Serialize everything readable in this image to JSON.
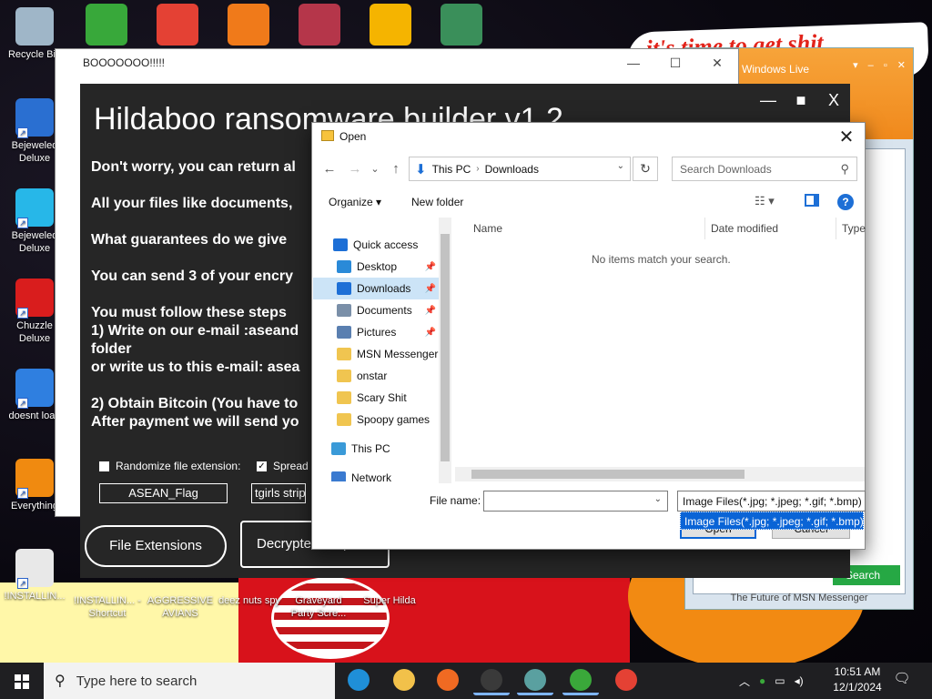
{
  "wallpaper": {
    "banner_text": "it's time to get shit"
  },
  "desktop_icons_left": [
    {
      "label": "Recycle Bin",
      "icon": "recycle-bin-icon",
      "color": "#9fb6c8"
    },
    {
      "label": "Bejeweled Deluxe",
      "icon": "bejeweled-red-gem-icon",
      "color": "#2a6fd1"
    },
    {
      "label": "Bejeweled Deluxe",
      "icon": "bejeweled-blue-gem-icon",
      "color": "#27b7e8"
    },
    {
      "label": "Chuzzle Deluxe",
      "icon": "chuzzle-icon",
      "color": "#d91d1d"
    },
    {
      "label": "doesnt load",
      "icon": "thunderbird-icon",
      "color": "#2f7fe0"
    },
    {
      "label": "Everything",
      "icon": "everything-search-icon",
      "color": "#f08a10"
    },
    {
      "label": "!INSTALLIN...",
      "icon": "document-icon",
      "color": "#e8e8e8"
    }
  ],
  "desktop_icons_top": [
    {
      "icon": "msn-messenger-icon",
      "color": "#38a83a"
    },
    {
      "icon": "chrome-icon",
      "color": "#e44134"
    },
    {
      "icon": "paint-p-icon",
      "color": "#f07a1a"
    },
    {
      "icon": "winrar-icon",
      "color": "#b5364a"
    },
    {
      "icon": "windows-shield-icon",
      "color": "#f5b400"
    },
    {
      "icon": "game-character-icon",
      "color": "#3a8f5a"
    }
  ],
  "desktop_icons_bottom": [
    {
      "label": "!INSTALLIN... - Shortcut"
    },
    {
      "label": "AGGRESSIVE AVIANS"
    },
    {
      "label": "deez nuts spy"
    },
    {
      "label": "Graveyard Party Scre..."
    },
    {
      "label": "Super Hilda"
    }
  ],
  "ransom_frame": {
    "title": "BOOOOOOO!!!!!",
    "min": "—",
    "max": "☐",
    "close": "✕"
  },
  "ransom": {
    "title": "Hildaboo ransomware builder v1.2",
    "lines": [
      "Don't worry, you can return al",
      "All your files like documents, ",
      "What guarantees do we give ",
      "You can send 3 of your encry",
      "You must follow these steps ",
      "1) Write on our e-mail :aseand",
      "folder",
      "or write us to this e-mail: asea",
      "2) Obtain Bitcoin (You have to",
      "After payment we will send yo"
    ],
    "check_randomize": "Randomize file extension:",
    "check_spread": "Spread",
    "ext_input": "ASEAN_Flag",
    "second_input": "tgirls strip",
    "btn_file_ext": "File Extensions",
    "btn_decrypter": "Decrypter & Options",
    "ctrl_min": "—",
    "ctrl_max": "■",
    "ctrl_close": "X"
  },
  "msn": {
    "title": "Windows Live",
    "controls": "▾ – ▫ ✕",
    "search_btn": "Search",
    "footer": "The Future of MSN Messenger"
  },
  "dialog": {
    "title": "Open",
    "close": "✕",
    "nav_back": "←",
    "nav_forward": "→",
    "nav_recent": "⌄",
    "nav_up": "↑",
    "breadcrumb": [
      "This PC",
      "Downloads"
    ],
    "search_placeholder": "Search Downloads",
    "organize": "Organize ▾",
    "new_folder": "New folder",
    "nav_items": [
      {
        "label": "Quick access",
        "icon": "star-icon",
        "color": "#1d6fd6",
        "pinned": false
      },
      {
        "label": "Desktop",
        "icon": "desktop-icon",
        "color": "#2a8ad8",
        "pinned": true
      },
      {
        "label": "Downloads",
        "icon": "downloads-icon",
        "color": "#1d6fd6",
        "pinned": true
      },
      {
        "label": "Documents",
        "icon": "documents-icon",
        "color": "#7a8fa8",
        "pinned": true
      },
      {
        "label": "Pictures",
        "icon": "pictures-icon",
        "color": "#5a7fb0",
        "pinned": true
      },
      {
        "label": "MSN Messenger",
        "icon": "folder-icon",
        "color": "#f0c550",
        "pinned": false
      },
      {
        "label": "onstar",
        "icon": "folder-icon",
        "color": "#f0c550",
        "pinned": false
      },
      {
        "label": "Scary Shit",
        "icon": "folder-icon",
        "color": "#f0c550",
        "pinned": false
      },
      {
        "label": "Spoopy games",
        "icon": "folder-icon",
        "color": "#f0c550",
        "pinned": false
      },
      {
        "label": "This PC",
        "icon": "this-pc-icon",
        "color": "#3a9ad8",
        "pinned": false
      },
      {
        "label": "Network",
        "icon": "network-icon",
        "color": "#3a7ad0",
        "pinned": false
      }
    ],
    "columns": [
      "Name",
      "Date modified",
      "Type"
    ],
    "empty_message": "No items match your search.",
    "filename_label": "File name:",
    "filename_value": "",
    "filter_value": "Image Files(*.jpg; *.jpeg; *.gif; *.bmp)",
    "filter_option": "Image Files(*.jpg; *.jpeg; *.gif; *.bmp)",
    "open_btn": "Open",
    "cancel_btn": "Cancel"
  },
  "taskbar": {
    "search_placeholder": "Type here to search",
    "apps": [
      {
        "icon": "edge-icon",
        "color": "#1f8fd8",
        "active": false
      },
      {
        "icon": "file-explorer-icon",
        "color": "#f2c14a",
        "active": false
      },
      {
        "icon": "firefox-icon",
        "color": "#f06a22",
        "active": false
      },
      {
        "icon": "chaos-app-icon",
        "color": "#3a3a3a",
        "active": true
      },
      {
        "icon": "app-window-icon",
        "color": "#5aa0a0",
        "active": true
      },
      {
        "icon": "msn-messenger-icon",
        "color": "#3aa83a",
        "active": true
      },
      {
        "icon": "chrome-icon",
        "color": "#e44134",
        "active": false
      }
    ],
    "tray": {
      "chevron": "︿",
      "time": "10:51 AM",
      "date": "12/1/2024",
      "notif": "🗨"
    }
  },
  "colors": {
    "accent": "#0a64d6",
    "ransom_bg": "#262626",
    "msn_orange": "#f0891c"
  }
}
